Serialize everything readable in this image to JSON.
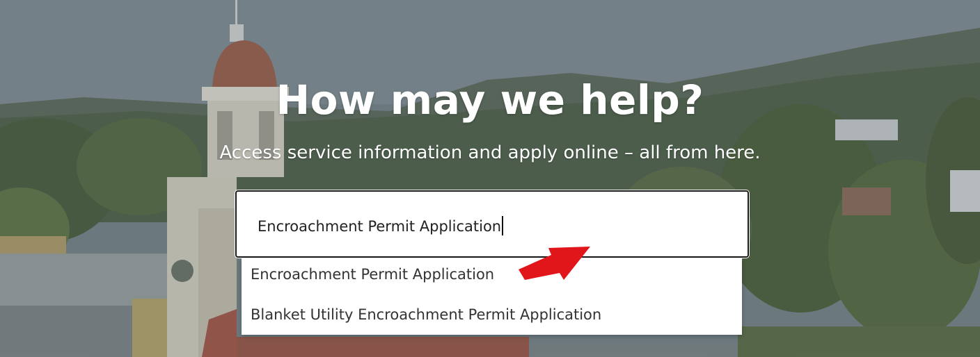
{
  "hero": {
    "title": "How may we help?",
    "subtitle": "Access service information and apply online – all from here."
  },
  "search": {
    "value": "Encroachment Permit Application",
    "placeholder": ""
  },
  "suggestions": [
    {
      "label": "Encroachment Permit Application",
      "highlighted": true
    },
    {
      "label": "Blanket Utility Encroachment Permit Application",
      "highlighted": false
    }
  ],
  "annotation": {
    "arrow_color": "#e0161b",
    "arrow_target": "suggestion-1"
  },
  "colors": {
    "title_text": "#ffffff",
    "input_border": "#1a1a1a",
    "dropdown_bg": "#ffffff"
  }
}
